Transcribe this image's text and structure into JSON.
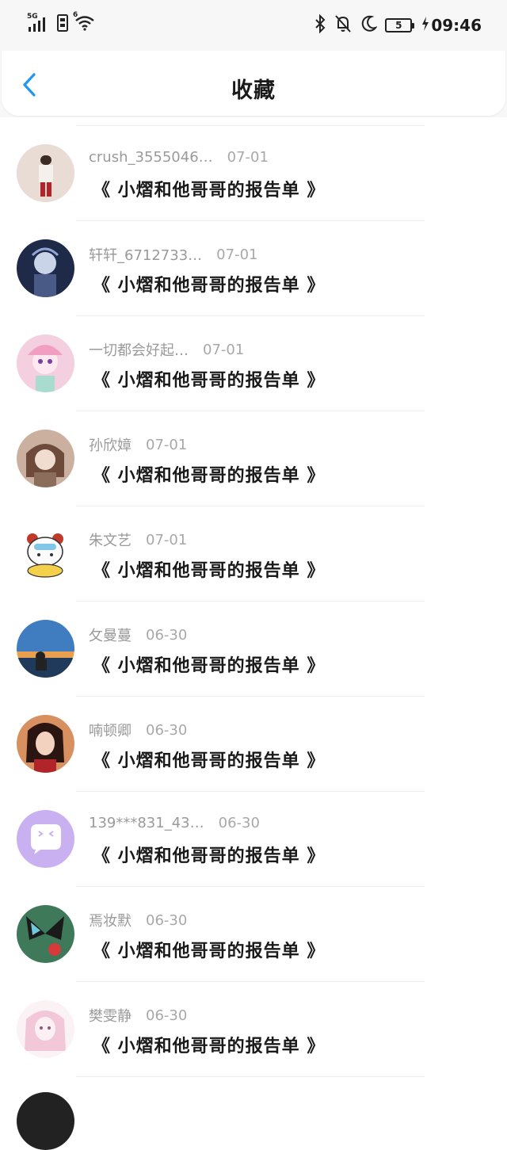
{
  "status_bar": {
    "network": "5G",
    "wifi_badge": "6",
    "battery": "5",
    "time": "09:46"
  },
  "header": {
    "title": "收藏"
  },
  "items": [
    {
      "user": "crush_3555046…",
      "date": "07-01",
      "title": "《 小熠和他哥哥的报告单 》",
      "avatar_bg": "#e8dcd6"
    },
    {
      "user": "轩轩_6712733…",
      "date": "07-01",
      "title": "《 小熠和他哥哥的报告单 》",
      "avatar_bg": "#2b3a5a"
    },
    {
      "user": "一切都会好起…",
      "date": "07-01",
      "title": "《 小熠和他哥哥的报告单 》",
      "avatar_bg": "#f3c6d8"
    },
    {
      "user": "孙欣嫜",
      "date": "07-01",
      "title": "《 小熠和他哥哥的报告单 》",
      "avatar_bg": "#c8aa98"
    },
    {
      "user": "朱文艺",
      "date": "07-01",
      "title": "《 小熠和他哥哥的报告单 》",
      "avatar_bg": "#ffffff"
    },
    {
      "user": "攵曼蔓",
      "date": "06-30",
      "title": "《 小熠和他哥哥的报告单 》",
      "avatar_bg": "#3a6aa8"
    },
    {
      "user": "喃顿卿",
      "date": "06-30",
      "title": "《 小熠和他哥哥的报告单 》",
      "avatar_bg": "#6b3a2a"
    },
    {
      "user": "139***831_43…",
      "date": "06-30",
      "title": "《 小熠和他哥哥的报告单 》",
      "avatar_bg": "#c9b0f0"
    },
    {
      "user": "焉妆默",
      "date": "06-30",
      "title": "《 小熠和他哥哥的报告单 》",
      "avatar_bg": "#3e7a5a"
    },
    {
      "user": "樊雯静",
      "date": "06-30",
      "title": "《 小熠和他哥哥的报告单 》",
      "avatar_bg": "#f3e4ec"
    }
  ]
}
